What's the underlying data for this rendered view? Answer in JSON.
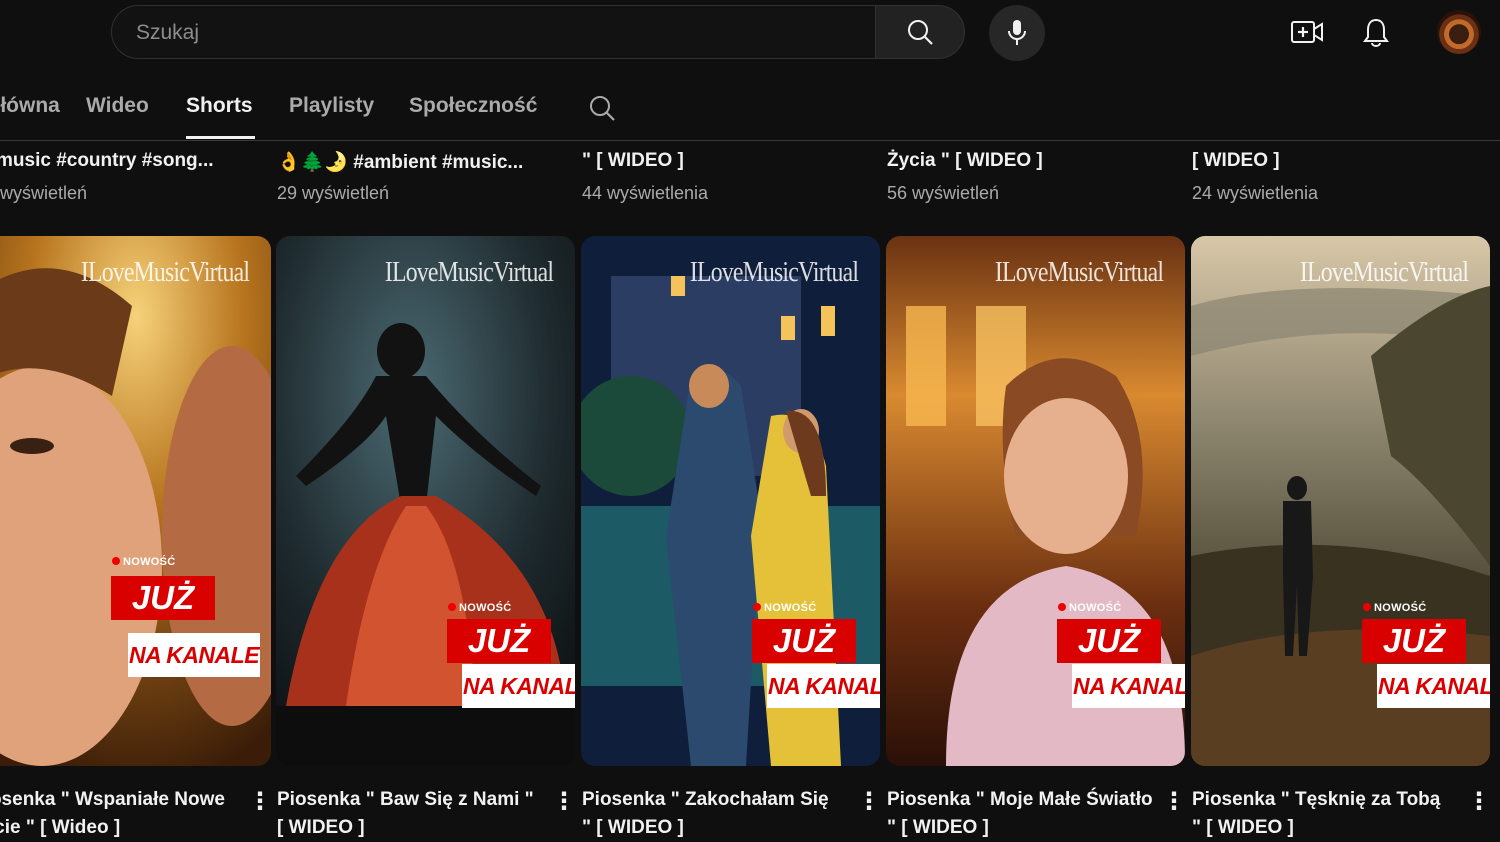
{
  "search": {
    "placeholder": "Szukaj"
  },
  "icons": {
    "search": "search-icon",
    "mic": "mic-icon",
    "create": "create-video-icon",
    "notifications": "bell-icon",
    "avatar": "avatar"
  },
  "tabs": [
    {
      "label": "Główna"
    },
    {
      "label": "Wideo"
    },
    {
      "label": "Shorts"
    },
    {
      "label": "Playlisty"
    },
    {
      "label": "Społeczność"
    }
  ],
  "upper_row": [
    {
      "title": "music #country #song...",
      "views": "wyświetleń"
    },
    {
      "title": "👌🌲🌛 #ambient #music...",
      "views": "29 wyświetleń"
    },
    {
      "title": "\" [ WIDEO ]",
      "views": "44 wyświetlenia"
    },
    {
      "title": "Życia \" [ WIDEO ]",
      "views": "56 wyświetleń"
    },
    {
      "title": "[ WIDEO ]",
      "views": "24 wyświetlenia"
    }
  ],
  "shorts": [
    {
      "title": "Piosenka \" Wspaniałe Nowe Życie \" [ Wideo ]",
      "watermark": "ILoveMusicVirtual",
      "badge_new": "NOWOŚĆ",
      "badge_juz": "JUŻ",
      "badge_kanal": "NA KANALE"
    },
    {
      "title": "Piosenka \" Baw Się z Nami \" [ WIDEO ]",
      "watermark": "ILoveMusicVirtual",
      "badge_new": "NOWOŚĆ",
      "badge_juz": "JUŻ",
      "badge_kanal": "NA KANALE"
    },
    {
      "title": "Piosenka \" Zakochałam Się \" [ WIDEO ]",
      "watermark": "ILoveMusicVirtual",
      "badge_new": "NOWOŚĆ",
      "badge_juz": "JUŻ",
      "badge_kanal": "NA KANALE"
    },
    {
      "title": "Piosenka \" Moje Małe Światło \" [ WIDEO ]",
      "watermark": "ILoveMusicVirtual",
      "badge_new": "NOWOŚĆ",
      "badge_juz": "JUŻ",
      "badge_kanal": "NA KANALE"
    },
    {
      "title": "Piosenka \" Tęsknię za Tobą \" [ WIDEO ]",
      "watermark": "ILoveMusicVirtual",
      "badge_new": "NOWOŚĆ",
      "badge_juz": "JUŻ",
      "badge_kanal": "NA KANALE"
    }
  ],
  "more_menu": "⋮"
}
